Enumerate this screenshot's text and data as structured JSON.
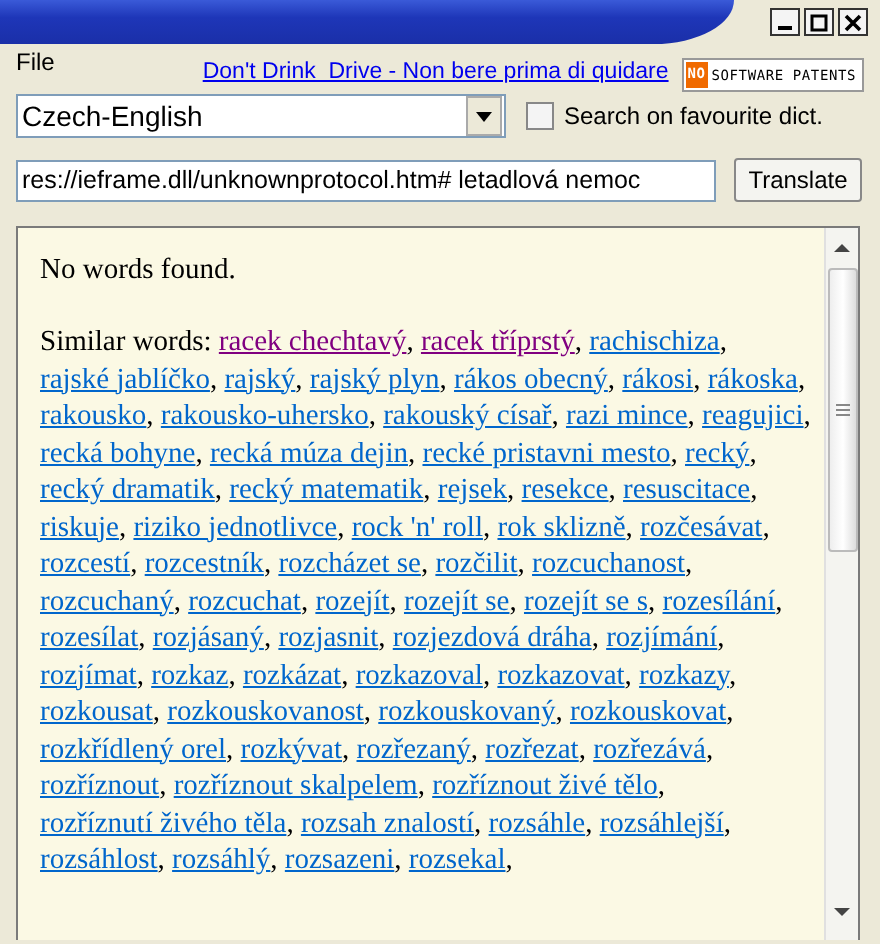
{
  "menu": [
    "File"
  ],
  "banner_link": "Don't Drink  Drive - Non bere prima di quidare",
  "badge": {
    "prefix": "NO",
    "text": "SOFTWARE PATENTS"
  },
  "dictionary": {
    "value": "Czech-English"
  },
  "favourite": {
    "label": "Search on favourite dict.",
    "checked": false
  },
  "search": {
    "value": "res://ieframe.dll/unknownprotocol.htm# letadlová nemoc"
  },
  "translate_button": "Translate",
  "results": {
    "message": "No words found.",
    "similar_label": "Similar words:",
    "separator": ",",
    "words": [
      {
        "text": "racek chechtavý",
        "visited": true
      },
      {
        "text": "racek tříprstý",
        "visited": true
      },
      {
        "text": "rachischiza",
        "visited": false
      },
      {
        "text": "rajské jablíčko",
        "visited": false
      },
      {
        "text": "rajský",
        "visited": false
      },
      {
        "text": "rajský plyn",
        "visited": false
      },
      {
        "text": "rákos obecný",
        "visited": false
      },
      {
        "text": "rákosi",
        "visited": false
      },
      {
        "text": "rákoska",
        "visited": false
      },
      {
        "text": "rakousko",
        "visited": false
      },
      {
        "text": "rakousko-uhersko",
        "visited": false
      },
      {
        "text": "rakouský císař",
        "visited": false
      },
      {
        "text": "razi mince",
        "visited": false
      },
      {
        "text": "reagujici",
        "visited": false
      },
      {
        "text": "recká bohyne",
        "visited": false
      },
      {
        "text": "recká múza dejin",
        "visited": false
      },
      {
        "text": "recké pristavni mesto",
        "visited": false
      },
      {
        "text": "recký",
        "visited": false
      },
      {
        "text": "recký dramatik",
        "visited": false
      },
      {
        "text": "recký matematik",
        "visited": false
      },
      {
        "text": "rejsek",
        "visited": false
      },
      {
        "text": "resekce",
        "visited": false
      },
      {
        "text": "resuscitace",
        "visited": false
      },
      {
        "text": "riskuje",
        "visited": false
      },
      {
        "text": "riziko jednotlivce",
        "visited": false
      },
      {
        "text": "rock 'n' roll",
        "visited": false
      },
      {
        "text": "rok sklizně",
        "visited": false
      },
      {
        "text": "rozčesávat",
        "visited": false
      },
      {
        "text": "rozcestí",
        "visited": false
      },
      {
        "text": "rozcestník",
        "visited": false
      },
      {
        "text": "rozcházet se",
        "visited": false
      },
      {
        "text": "rozčilit",
        "visited": false
      },
      {
        "text": "rozcuchanost",
        "visited": false
      },
      {
        "text": "rozcuchaný",
        "visited": false
      },
      {
        "text": "rozcuchat",
        "visited": false
      },
      {
        "text": "rozejít",
        "visited": false
      },
      {
        "text": "rozejít se",
        "visited": false
      },
      {
        "text": "rozejít se s",
        "visited": false
      },
      {
        "text": "rozesílání",
        "visited": false
      },
      {
        "text": "rozesílat",
        "visited": false
      },
      {
        "text": "rozjásaný",
        "visited": false
      },
      {
        "text": "rozjasnit",
        "visited": false
      },
      {
        "text": "rozjezdová dráha",
        "visited": false
      },
      {
        "text": "rozjímání",
        "visited": false
      },
      {
        "text": "rozjímat",
        "visited": false
      },
      {
        "text": "rozkaz",
        "visited": false
      },
      {
        "text": "rozkázat",
        "visited": false
      },
      {
        "text": "rozkazoval",
        "visited": false
      },
      {
        "text": "rozkazovat",
        "visited": false
      },
      {
        "text": "rozkazy",
        "visited": false
      },
      {
        "text": "rozkousat",
        "visited": false
      },
      {
        "text": "rozkouskovanost",
        "visited": false
      },
      {
        "text": "rozkouskovaný",
        "visited": false
      },
      {
        "text": "rozkouskovat",
        "visited": false
      },
      {
        "text": "rozkřídlený orel",
        "visited": false
      },
      {
        "text": "rozkývat",
        "visited": false
      },
      {
        "text": "rozřezaný",
        "visited": false
      },
      {
        "text": "rozřezat",
        "visited": false
      },
      {
        "text": "rozřezává",
        "visited": false
      },
      {
        "text": "rozříznout",
        "visited": false
      },
      {
        "text": "rozříznout skalpelem",
        "visited": false
      },
      {
        "text": "rozříznout živé tělo",
        "visited": false
      },
      {
        "text": "rozříznutí živého těla",
        "visited": false
      },
      {
        "text": "rozsah znalostí",
        "visited": false
      },
      {
        "text": "rozsáhle",
        "visited": false
      },
      {
        "text": "rozsáhlejší",
        "visited": false
      },
      {
        "text": "rozsáhlost",
        "visited": false
      },
      {
        "text": "rozsáhlý",
        "visited": false
      },
      {
        "text": "rozsazeni",
        "visited": false
      },
      {
        "text": "rozsekal",
        "visited": false
      }
    ]
  }
}
